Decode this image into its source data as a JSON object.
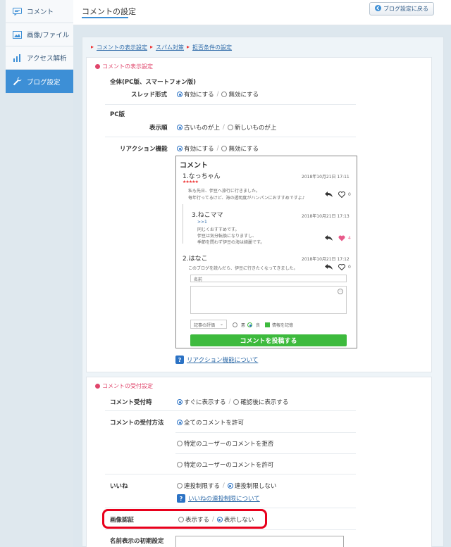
{
  "sidebar": {
    "items": [
      {
        "label": "コメント",
        "icon": "comment-icon"
      },
      {
        "label": "画像/ファイル",
        "icon": "image-icon"
      },
      {
        "label": "アクセス解析",
        "icon": "chart-icon"
      },
      {
        "label": "ブログ設定",
        "icon": "wrench-icon"
      }
    ]
  },
  "header": {
    "title": "コメントの設定",
    "back_label": "ブログ設定に戻る"
  },
  "breadcrumb": [
    "コメントの表示設定",
    "スパム対策",
    "拒否条件の設定"
  ],
  "display": {
    "heading": "コメントの表示設定",
    "all_label": "全体(PC版、スマートフォン版)",
    "thread_label": "スレッド形式",
    "thread_on": "有効にする",
    "thread_off": "無効にする",
    "pc_label": "PC版",
    "order_label": "表示順",
    "order_old": "古いものが上",
    "order_new": "新しいものが上",
    "reaction_label": "リアクション機能",
    "reaction_on": "有効にする",
    "reaction_off": "無効にする",
    "reaction_help": "リアクション機能について"
  },
  "preview": {
    "title": "コメント",
    "c1_name": "1.なっちゃん",
    "c1_date": "2018年10月21日 17:11",
    "c1_stars": "★★★★★",
    "c1_line1": "私も先日、伊豆へ旅行に行きました。",
    "c1_line2": "毎年行ってるけど、海の透明度がハンパンにおすすめですよ♪",
    "c1_count": "0",
    "c3_name": "3.ねこママ",
    "c3_date": "2018年10月21日 17:13",
    "c3_reply": ">>1",
    "c3_line1": "同じくおすすめです。",
    "c3_line2": "伊豆は気分転換になりますし、",
    "c3_line3": "季節を問わず伊豆の海は綺麗です。",
    "c3_count": "4",
    "c2_name": "2.はなこ",
    "c2_date": "2018年10月21日 17:12",
    "c2_line1": "このブログを読んだら、伊豆に行きたくなってきました。",
    "c2_count": "0",
    "name_placeholder": "名前",
    "rating_label": "記事の評価",
    "opt_bad": "悪",
    "opt_good": "良",
    "remember": "情報を記憶",
    "submit": "コメントを投稿する"
  },
  "accept": {
    "heading": "コメントの受付設定",
    "timing_label": "コメント受付時",
    "timing_now": "すぐに表示する",
    "timing_after": "確認後に表示する",
    "method_label": "コメントの受付方法",
    "method_all": "全てのコメントを許可",
    "method_reject": "特定のユーザーのコメントを拒否",
    "method_allow": "特定のユーザーのコメントを許可",
    "like_label": "いいね",
    "like_limit": "連投制限する",
    "like_nolimit": "連投制限しない",
    "like_help": "いいねの連投制限について",
    "captcha_label": "画像認証",
    "captcha_show": "表示する",
    "captcha_hide": "表示しない",
    "name_default_label": "名前表示の初期設定"
  },
  "colors": {
    "accent": "#3d8fd6",
    "pink": "#e0456b",
    "green": "#3dba3d",
    "red": "#e8001c"
  }
}
